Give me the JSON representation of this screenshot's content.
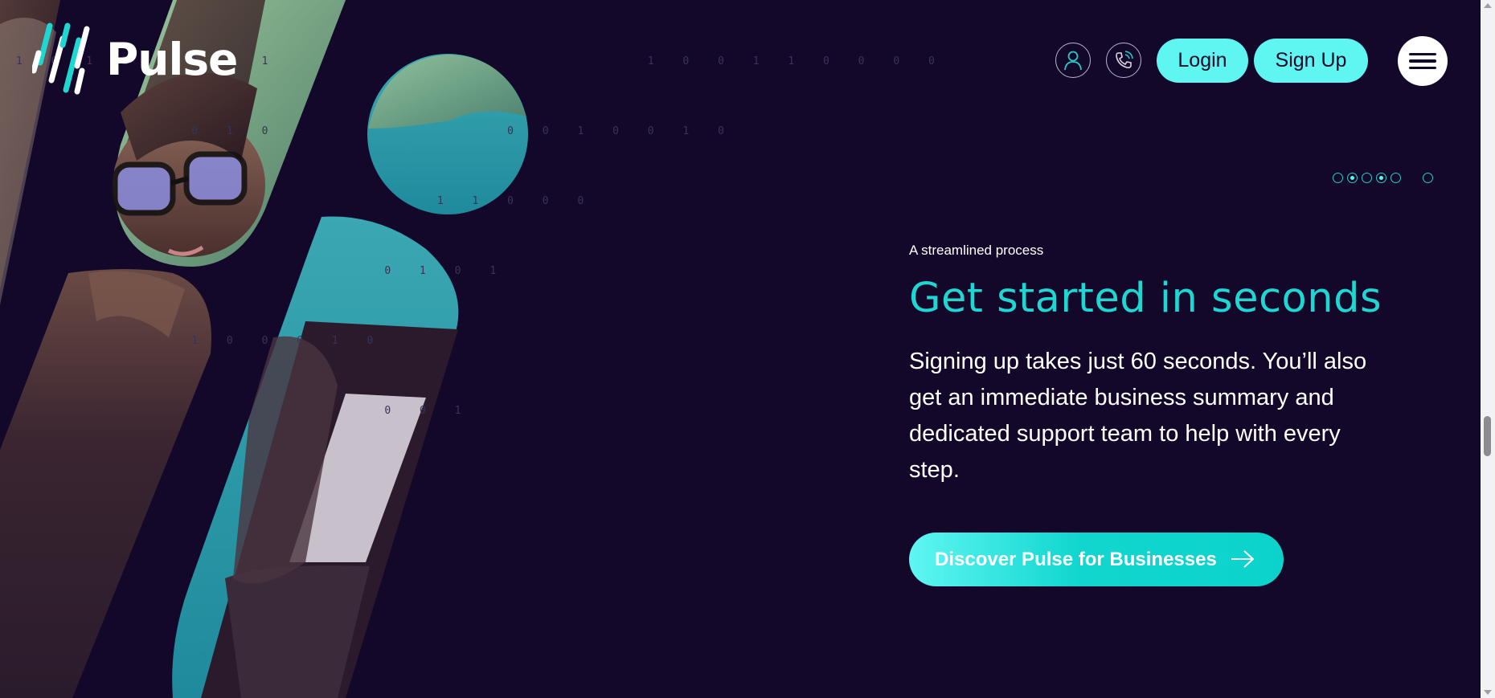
{
  "brand": {
    "name": "Pulse",
    "logo_icon": "pulse-bars-logo",
    "accent_color": "#1fd7d2",
    "button_color": "#5ff6f2",
    "background_color": "#14082a"
  },
  "header": {
    "account_icon": "user-icon",
    "contact_icon": "phone-icon",
    "login_label": "Login",
    "signup_label": "Sign Up",
    "menu_icon": "hamburger-menu-icon"
  },
  "slider": {
    "dot_count": 6,
    "active_dots": [
      2,
      4
    ]
  },
  "hero": {
    "eyebrow": "A streamlined process",
    "headline": "Get started in seconds",
    "body": "Signing up takes just 60 seconds. You’ll also get an immediate business summary and dedicated support team to help with every step.",
    "cta_label": "Discover Pulse for Businesses",
    "cta_icon": "arrow-right-icon"
  },
  "imagery": {
    "binary_lines": [
      "1 0 1 1 1 1 1 1                     1 0 0 1 1 0 0 0 0",
      "          0 1 0             0 0 1 0 0 1 0",
      "                        1 1 0 0 0",
      "                     0 1 0 1",
      "          1 0 0 0 1 0",
      "                     0 0 1"
    ]
  }
}
